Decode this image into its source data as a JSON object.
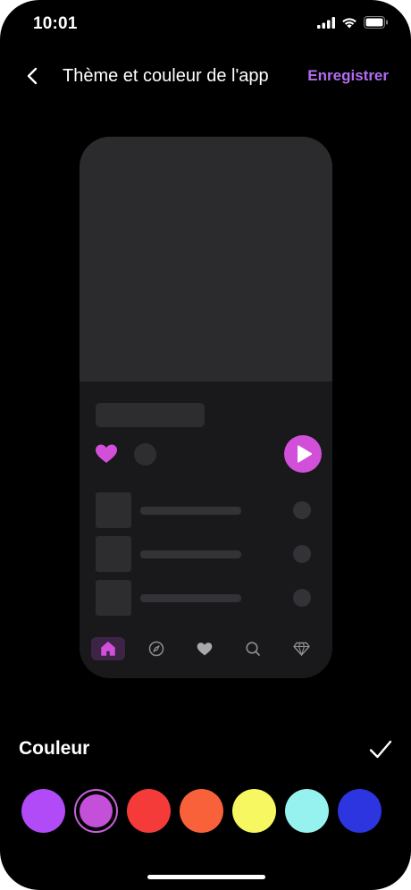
{
  "status_bar": {
    "time": "10:01"
  },
  "nav": {
    "title": "Thème et couleur de l'app",
    "save_label": "Enregistrer"
  },
  "preview": {
    "accent": "#d250d9",
    "tabs": [
      "home-icon",
      "compass-icon",
      "heart-icon",
      "search-icon",
      "diamond-icon"
    ],
    "active_tab": "home-icon"
  },
  "color_section": {
    "label": "Couleur",
    "selected_color": "#c44fd8",
    "swatches": [
      "#b14af7",
      "#c44fd8",
      "#f53a3a",
      "#f8613a",
      "#f7f761",
      "#95f2ef",
      "#2d35e0"
    ]
  }
}
